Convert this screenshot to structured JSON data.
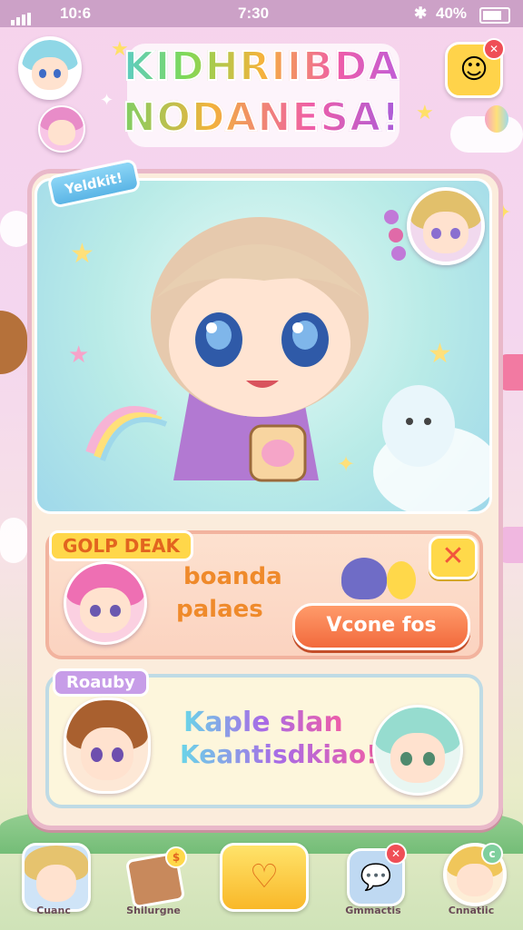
{
  "status_bar": {
    "carrier": "10:6",
    "time": "7:30",
    "battery": "40%"
  },
  "title": {
    "line1": "KIDHRIIBDA",
    "line2": "NODANESA!"
  },
  "hero": {
    "tag": "Yeldkit!"
  },
  "deal_card": {
    "ribbon": "GOLP DEAK",
    "text_line1": "boanda",
    "text_line2": "palaes",
    "button": "Vcone fos",
    "close_icon": "✕"
  },
  "royalty_card": {
    "ribbon": "Roauby",
    "text_line1": "Kaple slan",
    "text_line2": "Keantisdkiao!"
  },
  "bottom_nav": [
    {
      "label": "Cuanc"
    },
    {
      "label": "Shilurgne"
    },
    {
      "label": ""
    },
    {
      "label": "Gmmactis"
    },
    {
      "label": "Cnnatiic"
    }
  ],
  "colors": {
    "accent_orange": "#f26a3d",
    "gold": "#ffd74a",
    "panel": "#fbecdc",
    "pink_bg": "#f6d3ec"
  }
}
